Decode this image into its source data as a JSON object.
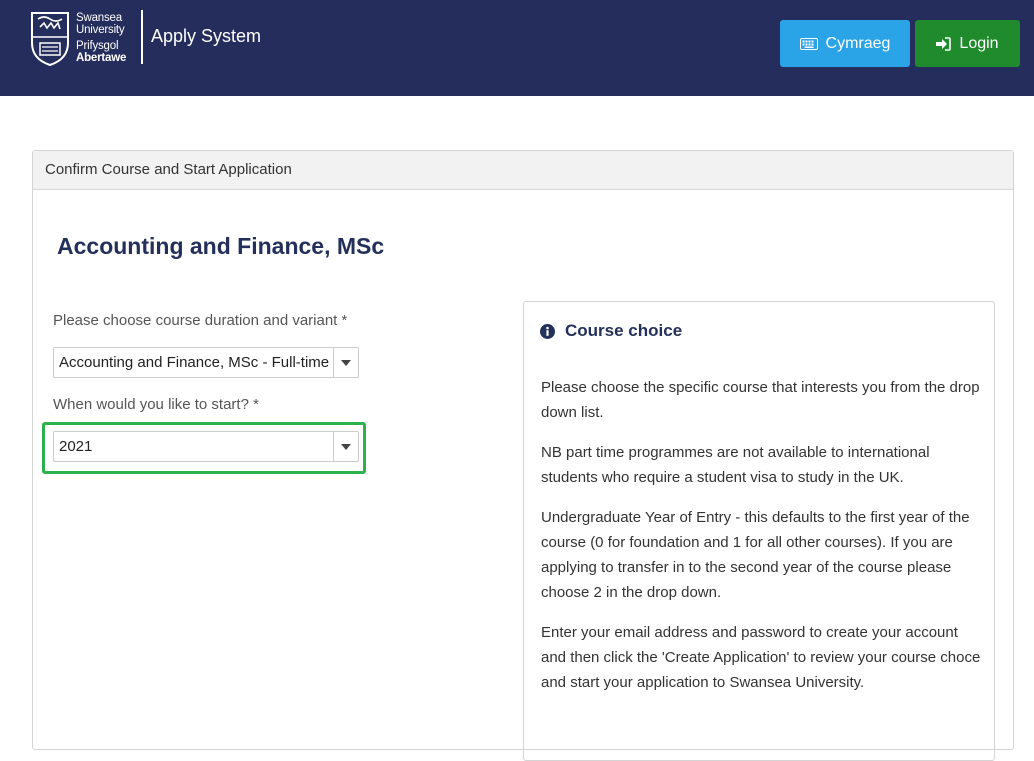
{
  "header": {
    "logo": {
      "line1": "Swansea",
      "line2": "University",
      "line3": "Prifysgol",
      "line4": "Abertawe"
    },
    "app_title": "Apply System",
    "cymraeg_label": "Cymraeg",
    "login_label": "Login",
    "colors": {
      "bar": "#242d5c",
      "cymraeg": "#2aa3e7",
      "login": "#1f8b2c"
    },
    "icons": {
      "cymraeg": "keyboard-icon",
      "login": "sign-in-icon"
    }
  },
  "panel": {
    "heading": "Confirm Course and Start Application",
    "course_title": "Accounting and Finance, MSc",
    "duration_label": "Please choose course duration and variant *",
    "duration_value": "Accounting and Finance, MSc - Full-time",
    "start_label": "When would you like to start? *",
    "start_value": "2021"
  },
  "info": {
    "icon": "info-circle-icon",
    "title": "Course choice",
    "paragraphs": [
      "Please choose the specific course that interests you from the drop down list.",
      "NB part time programmes are not available to international students who require a student visa to study in the UK.",
      "Undergraduate Year of Entry - this defaults to the first year of the course (0 for foundation and 1 for all other courses). If you are applying to transfer in to the second year of the course please choose 2 in the drop down.",
      "Enter your email address and password to create your account and then click the 'Create Application' to review your course choce and start your application to Swansea University."
    ]
  }
}
